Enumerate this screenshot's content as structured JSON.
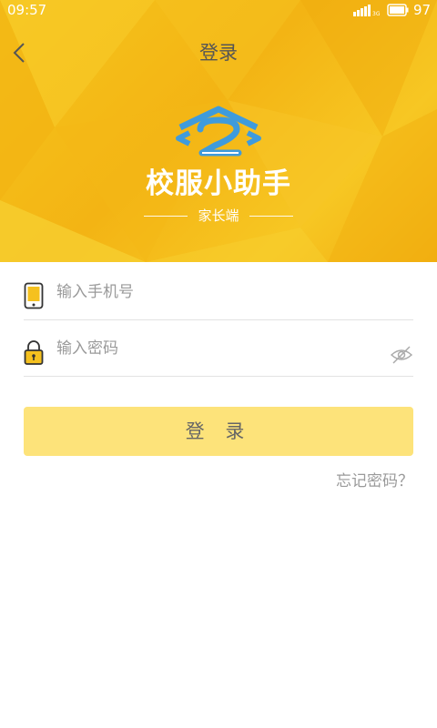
{
  "status_bar": {
    "time": "09:57",
    "network": "3G",
    "battery": "97"
  },
  "header": {
    "title": "登录",
    "app_name": "校服小助手",
    "subtitle": "家长端"
  },
  "form": {
    "phone_placeholder": "输入手机号",
    "password_placeholder": "输入密码",
    "login_label": "登 录",
    "forgot_label": "忘记密码？"
  },
  "icons": {
    "back": "chevron-left-icon",
    "phone": "smartphone-icon",
    "lock": "lock-icon",
    "eye": "eye-off-icon",
    "logo": "graduation-cap-logo"
  },
  "colors": {
    "hero_yellow": "#f5bb18",
    "button_yellow": "#fde37a",
    "logo_blue": "#3f9bdc",
    "placeholder_gray": "#9a9a9a"
  }
}
